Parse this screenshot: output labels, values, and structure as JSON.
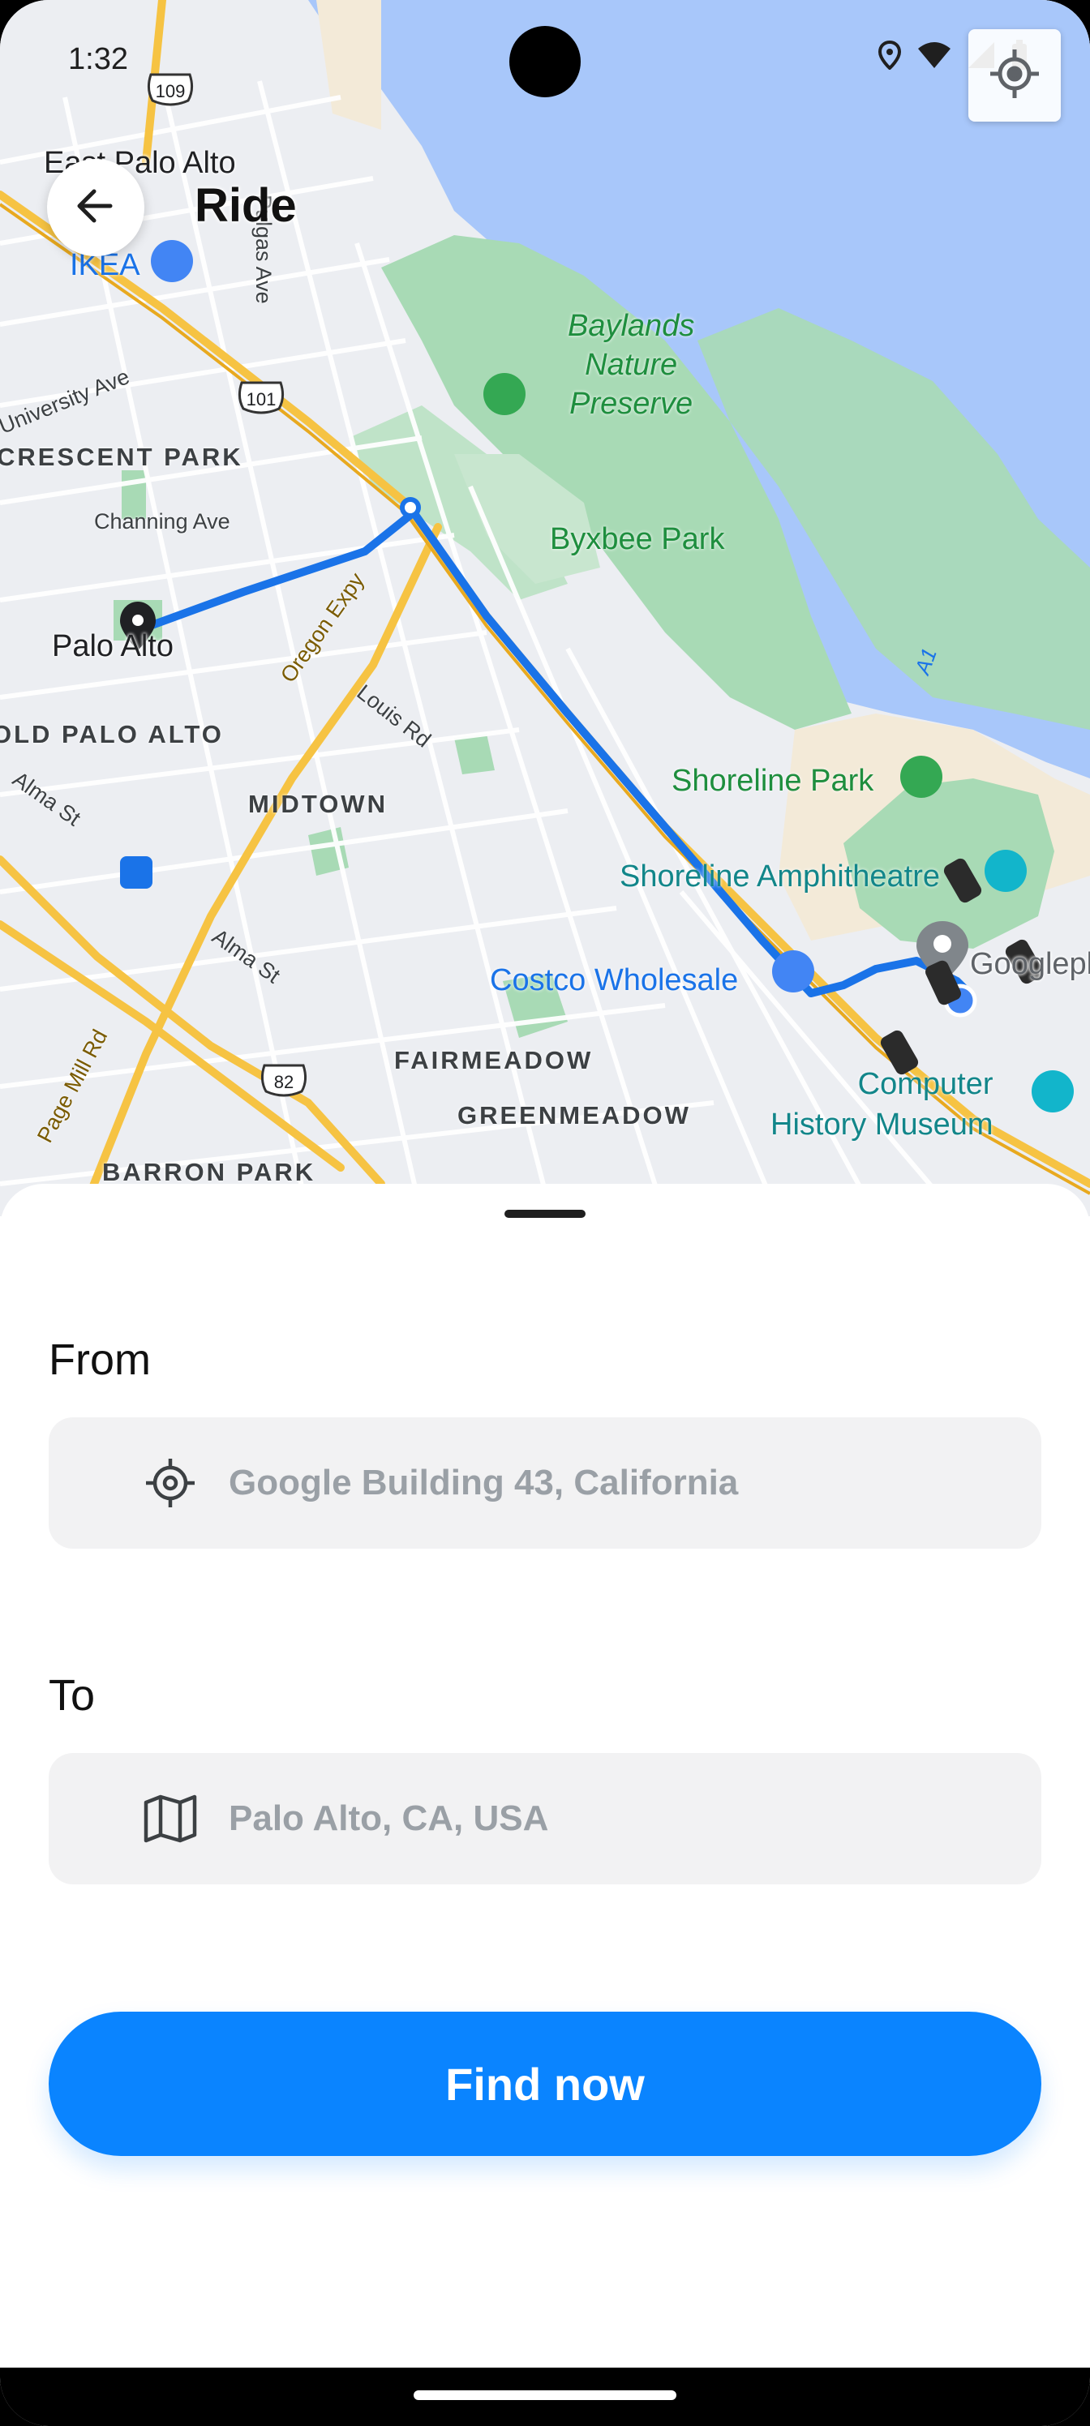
{
  "status_bar": {
    "time": "1:32",
    "icons": [
      "location-icon",
      "wifi-icon",
      "signal-icon",
      "battery-icon"
    ]
  },
  "header": {
    "title": "Ride",
    "back_icon": "arrow-left-icon"
  },
  "map": {
    "locate_icon": "gps-crosshair-icon",
    "labels": {
      "east_palo_alto": "East Palo Alto",
      "ikea": "IKEA",
      "pulgas_ave": "Pulgas Ave",
      "university_ave": "University Ave",
      "hwy_109": "109",
      "hwy_101": "101",
      "hwy_82": "82",
      "crescent_park": "CRESCENT PARK",
      "channing_ave": "Channing Ave",
      "baylands": "Baylands\nNature\nPreserve",
      "byxbee_park": "Byxbee Park",
      "palo_alto": "Palo Alto",
      "old_palo_alto": "OLD PALO ALTO",
      "oregon_expy": "Oregon Expy",
      "louis_rd": "Louis Rd",
      "alma_st_1": "Alma St",
      "alma_st_2": "Alma St",
      "midtown": "MIDTOWN",
      "shoreline_park": "Shoreline Park",
      "shoreline_amphitheatre": "Shoreline Amphitheatre",
      "googleplex": "Googleplex",
      "costco": "Costco Wholesale",
      "fairmeadow": "FAIRMEADOW",
      "greenmeadow": "GREENMEADOW",
      "computer_history_museum": "Computer\nHistory Museum",
      "page_mill_rd": "Page Mill Rd",
      "barron_park": "BARRON PARK",
      "a1": "A1"
    },
    "colors": {
      "water": "#a8c7fa",
      "park": "#a8dab5",
      "land": "#eef0f3",
      "route": "#1a73e8",
      "highway": "#f6c343"
    }
  },
  "form": {
    "from_label": "From",
    "from_placeholder": "Google Building 43, California",
    "from_icon": "gps-target-icon",
    "to_label": "To",
    "to_placeholder": "Palo Alto, CA, USA",
    "to_icon": "map-icon",
    "submit_label": "Find now"
  },
  "colors": {
    "accent": "#0a84ff",
    "field_bg": "#f2f2f3",
    "placeholder": "#9aa0a6"
  }
}
